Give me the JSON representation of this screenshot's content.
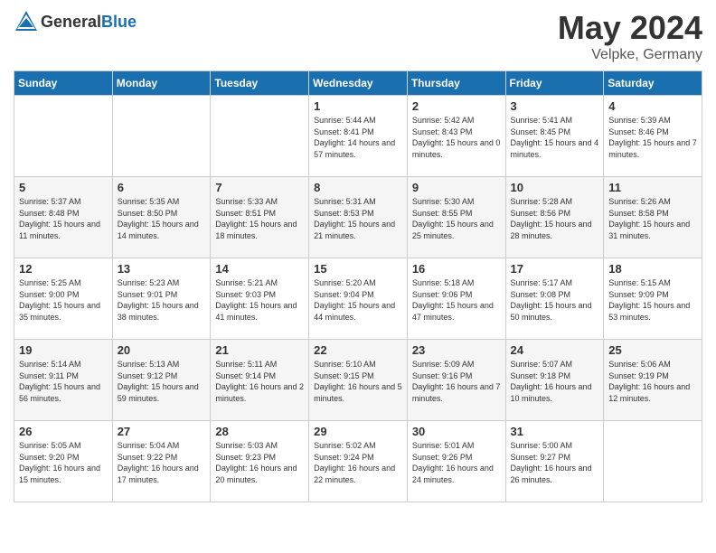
{
  "header": {
    "logo_general": "General",
    "logo_blue": "Blue",
    "month": "May 2024",
    "location": "Velpke, Germany"
  },
  "days_of_week": [
    "Sunday",
    "Monday",
    "Tuesday",
    "Wednesday",
    "Thursday",
    "Friday",
    "Saturday"
  ],
  "weeks": [
    [
      {
        "day": "",
        "info": ""
      },
      {
        "day": "",
        "info": ""
      },
      {
        "day": "",
        "info": ""
      },
      {
        "day": "1",
        "sunrise": "5:44 AM",
        "sunset": "8:41 PM",
        "daylight": "14 hours and 57 minutes."
      },
      {
        "day": "2",
        "sunrise": "5:42 AM",
        "sunset": "8:43 PM",
        "daylight": "15 hours and 0 minutes."
      },
      {
        "day": "3",
        "sunrise": "5:41 AM",
        "sunset": "8:45 PM",
        "daylight": "15 hours and 4 minutes."
      },
      {
        "day": "4",
        "sunrise": "5:39 AM",
        "sunset": "8:46 PM",
        "daylight": "15 hours and 7 minutes."
      }
    ],
    [
      {
        "day": "5",
        "sunrise": "5:37 AM",
        "sunset": "8:48 PM",
        "daylight": "15 hours and 11 minutes."
      },
      {
        "day": "6",
        "sunrise": "5:35 AM",
        "sunset": "8:50 PM",
        "daylight": "15 hours and 14 minutes."
      },
      {
        "day": "7",
        "sunrise": "5:33 AM",
        "sunset": "8:51 PM",
        "daylight": "15 hours and 18 minutes."
      },
      {
        "day": "8",
        "sunrise": "5:31 AM",
        "sunset": "8:53 PM",
        "daylight": "15 hours and 21 minutes."
      },
      {
        "day": "9",
        "sunrise": "5:30 AM",
        "sunset": "8:55 PM",
        "daylight": "15 hours and 25 minutes."
      },
      {
        "day": "10",
        "sunrise": "5:28 AM",
        "sunset": "8:56 PM",
        "daylight": "15 hours and 28 minutes."
      },
      {
        "day": "11",
        "sunrise": "5:26 AM",
        "sunset": "8:58 PM",
        "daylight": "15 hours and 31 minutes."
      }
    ],
    [
      {
        "day": "12",
        "sunrise": "5:25 AM",
        "sunset": "9:00 PM",
        "daylight": "15 hours and 35 minutes."
      },
      {
        "day": "13",
        "sunrise": "5:23 AM",
        "sunset": "9:01 PM",
        "daylight": "15 hours and 38 minutes."
      },
      {
        "day": "14",
        "sunrise": "5:21 AM",
        "sunset": "9:03 PM",
        "daylight": "15 hours and 41 minutes."
      },
      {
        "day": "15",
        "sunrise": "5:20 AM",
        "sunset": "9:04 PM",
        "daylight": "15 hours and 44 minutes."
      },
      {
        "day": "16",
        "sunrise": "5:18 AM",
        "sunset": "9:06 PM",
        "daylight": "15 hours and 47 minutes."
      },
      {
        "day": "17",
        "sunrise": "5:17 AM",
        "sunset": "9:08 PM",
        "daylight": "15 hours and 50 minutes."
      },
      {
        "day": "18",
        "sunrise": "5:15 AM",
        "sunset": "9:09 PM",
        "daylight": "15 hours and 53 minutes."
      }
    ],
    [
      {
        "day": "19",
        "sunrise": "5:14 AM",
        "sunset": "9:11 PM",
        "daylight": "15 hours and 56 minutes."
      },
      {
        "day": "20",
        "sunrise": "5:13 AM",
        "sunset": "9:12 PM",
        "daylight": "15 hours and 59 minutes."
      },
      {
        "day": "21",
        "sunrise": "5:11 AM",
        "sunset": "9:14 PM",
        "daylight": "16 hours and 2 minutes."
      },
      {
        "day": "22",
        "sunrise": "5:10 AM",
        "sunset": "9:15 PM",
        "daylight": "16 hours and 5 minutes."
      },
      {
        "day": "23",
        "sunrise": "5:09 AM",
        "sunset": "9:16 PM",
        "daylight": "16 hours and 7 minutes."
      },
      {
        "day": "24",
        "sunrise": "5:07 AM",
        "sunset": "9:18 PM",
        "daylight": "16 hours and 10 minutes."
      },
      {
        "day": "25",
        "sunrise": "5:06 AM",
        "sunset": "9:19 PM",
        "daylight": "16 hours and 12 minutes."
      }
    ],
    [
      {
        "day": "26",
        "sunrise": "5:05 AM",
        "sunset": "9:20 PM",
        "daylight": "16 hours and 15 minutes."
      },
      {
        "day": "27",
        "sunrise": "5:04 AM",
        "sunset": "9:22 PM",
        "daylight": "16 hours and 17 minutes."
      },
      {
        "day": "28",
        "sunrise": "5:03 AM",
        "sunset": "9:23 PM",
        "daylight": "16 hours and 20 minutes."
      },
      {
        "day": "29",
        "sunrise": "5:02 AM",
        "sunset": "9:24 PM",
        "daylight": "16 hours and 22 minutes."
      },
      {
        "day": "30",
        "sunrise": "5:01 AM",
        "sunset": "9:26 PM",
        "daylight": "16 hours and 24 minutes."
      },
      {
        "day": "31",
        "sunrise": "5:00 AM",
        "sunset": "9:27 PM",
        "daylight": "16 hours and 26 minutes."
      },
      {
        "day": "",
        "info": ""
      }
    ]
  ],
  "labels": {
    "sunrise_prefix": "Sunrise: ",
    "sunset_prefix": "Sunset: ",
    "daylight_prefix": "Daylight: "
  }
}
